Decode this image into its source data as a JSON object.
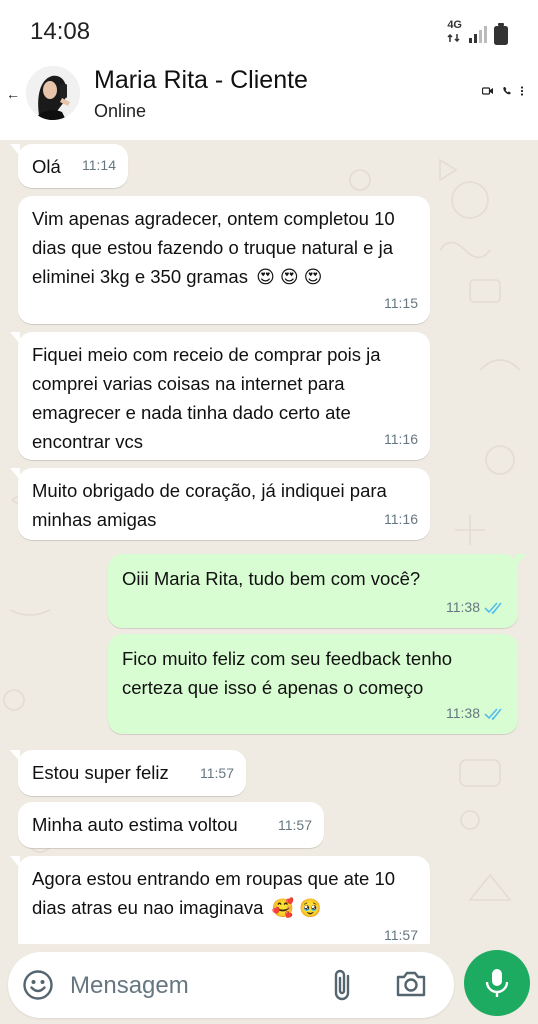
{
  "status_bar": {
    "time": "14:08",
    "network": "4G"
  },
  "header": {
    "back_icon": "arrow-left-icon",
    "contact_name": "Maria Rita - Cliente",
    "contact_status": "Online"
  },
  "messages": [
    {
      "direction": "in",
      "text": "Olá",
      "time": "11:14"
    },
    {
      "direction": "in",
      "text": "Vim apenas agradecer, ontem completou 10 dias que estou fazendo o truque natural e ja eliminei 3kg e 350 gramas",
      "emoji": "😍 😍 😍",
      "time": "11:15"
    },
    {
      "direction": "in",
      "text": "Fiquei meio com receio de comprar pois ja comprei varias coisas na internet para emagrecer e nada tinha dado certo ate encontrar vcs",
      "time": "11:16"
    },
    {
      "direction": "in",
      "text": "Muito obrigado de coração, já indiquei para minhas amigas",
      "time": "11:16"
    },
    {
      "direction": "out",
      "text": "Oiii Maria Rita, tudo bem com você?",
      "time": "11:38",
      "status": "read"
    },
    {
      "direction": "out",
      "text": "Fico muito feliz com seu feedback tenho certeza que isso é apenas o começo",
      "time": "11:38",
      "status": "read"
    },
    {
      "direction": "in",
      "text": "Estou super feliz",
      "time": "11:57"
    },
    {
      "direction": "in",
      "text": "Minha auto estima voltou",
      "time": "11:57"
    },
    {
      "direction": "in",
      "text": "Agora estou entrando em roupas que ate 10 dias atras eu nao imaginava",
      "emoji": "🥰 🥹",
      "time": "11:57"
    }
  ],
  "composer": {
    "placeholder": "Mensagem"
  },
  "colors": {
    "chat_bg": "#efeae2",
    "outgoing_bubble": "#d9fdd3",
    "incoming_bubble": "#ffffff",
    "read_tick": "#53bdeb",
    "mic_button": "#1daa61"
  }
}
